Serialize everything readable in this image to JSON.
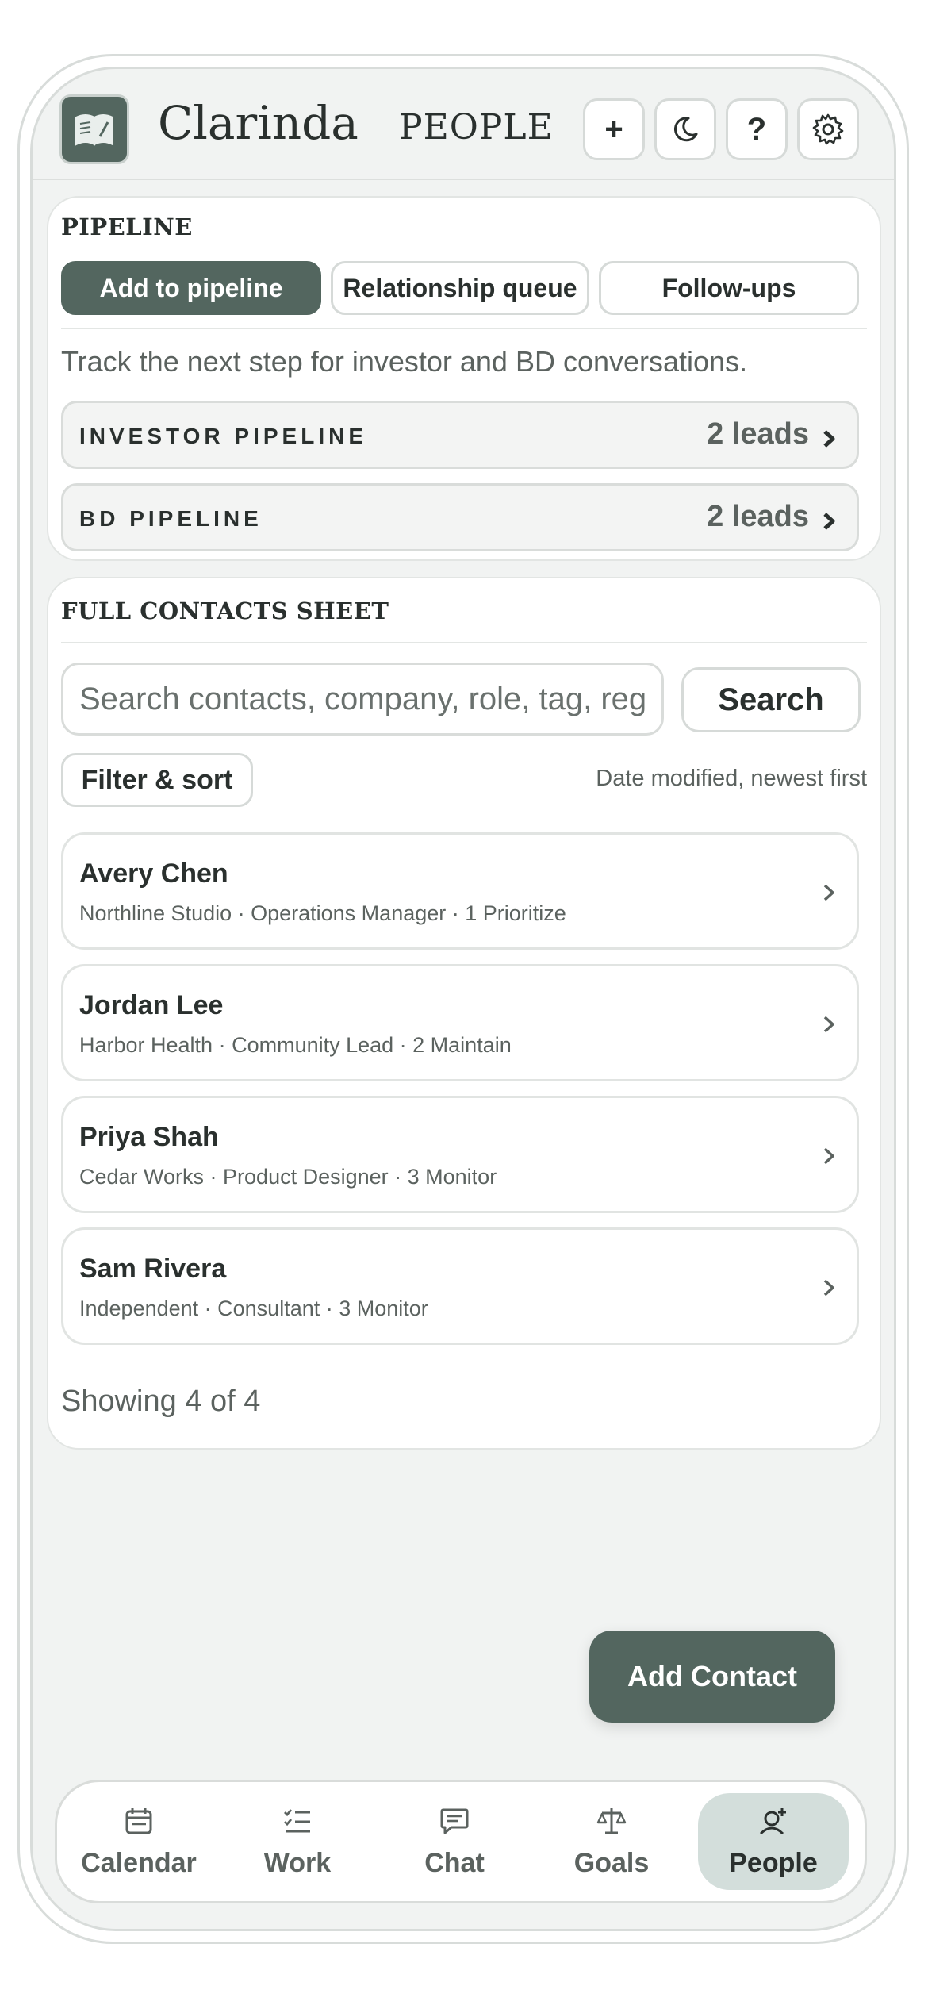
{
  "header": {
    "app_name": "Clarinda",
    "section": "PEOPLE",
    "actions": [
      {
        "label": "+",
        "icon": "plus-icon"
      },
      {
        "label": "",
        "icon": "moon-icon"
      },
      {
        "label": "?",
        "icon": "help-icon"
      },
      {
        "label": "",
        "icon": "gear-icon"
      }
    ]
  },
  "pipeline": {
    "heading": "PIPELINE",
    "buttons": [
      "Add to pipeline",
      "Relationship queue",
      "Follow-ups"
    ],
    "hint": "Track the next step for investor and BD conversations.",
    "rows": [
      {
        "label": "INVESTOR PIPELINE",
        "count": "2 leads"
      },
      {
        "label": "BD PIPELINE",
        "count": "2 leads"
      }
    ]
  },
  "contacts": {
    "heading": "FULL CONTACTS SHEET",
    "search_placeholder": "Search contacts, company, role, tag, region",
    "search_button": "Search",
    "filter_button": "Filter & sort",
    "sort_label": "Date modified, newest first",
    "items": [
      {
        "name": "Avery Chen",
        "meta": "Northline Studio · Operations Manager · 1 Prioritize"
      },
      {
        "name": "Jordan Lee",
        "meta": "Harbor Health · Community Lead · 2 Maintain"
      },
      {
        "name": "Priya Shah",
        "meta": "Cedar Works · Product Designer · 3 Monitor"
      },
      {
        "name": "Sam Rivera",
        "meta": "Independent · Consultant · 3 Monitor"
      }
    ],
    "showing": "Showing 4 of 4"
  },
  "fab": {
    "label": "Add Contact"
  },
  "tabs": [
    {
      "label": "Calendar",
      "icon": "calendar-icon",
      "active": false
    },
    {
      "label": "Work",
      "icon": "checklist-icon",
      "active": false
    },
    {
      "label": "Chat",
      "icon": "chat-icon",
      "active": false
    },
    {
      "label": "Goals",
      "icon": "scale-icon",
      "active": false
    },
    {
      "label": "People",
      "icon": "person-add-icon",
      "active": true
    }
  ],
  "colors": {
    "accent": "#53665f",
    "active_tab_bg": "#d3dedb",
    "background": "#f1f3f2"
  }
}
